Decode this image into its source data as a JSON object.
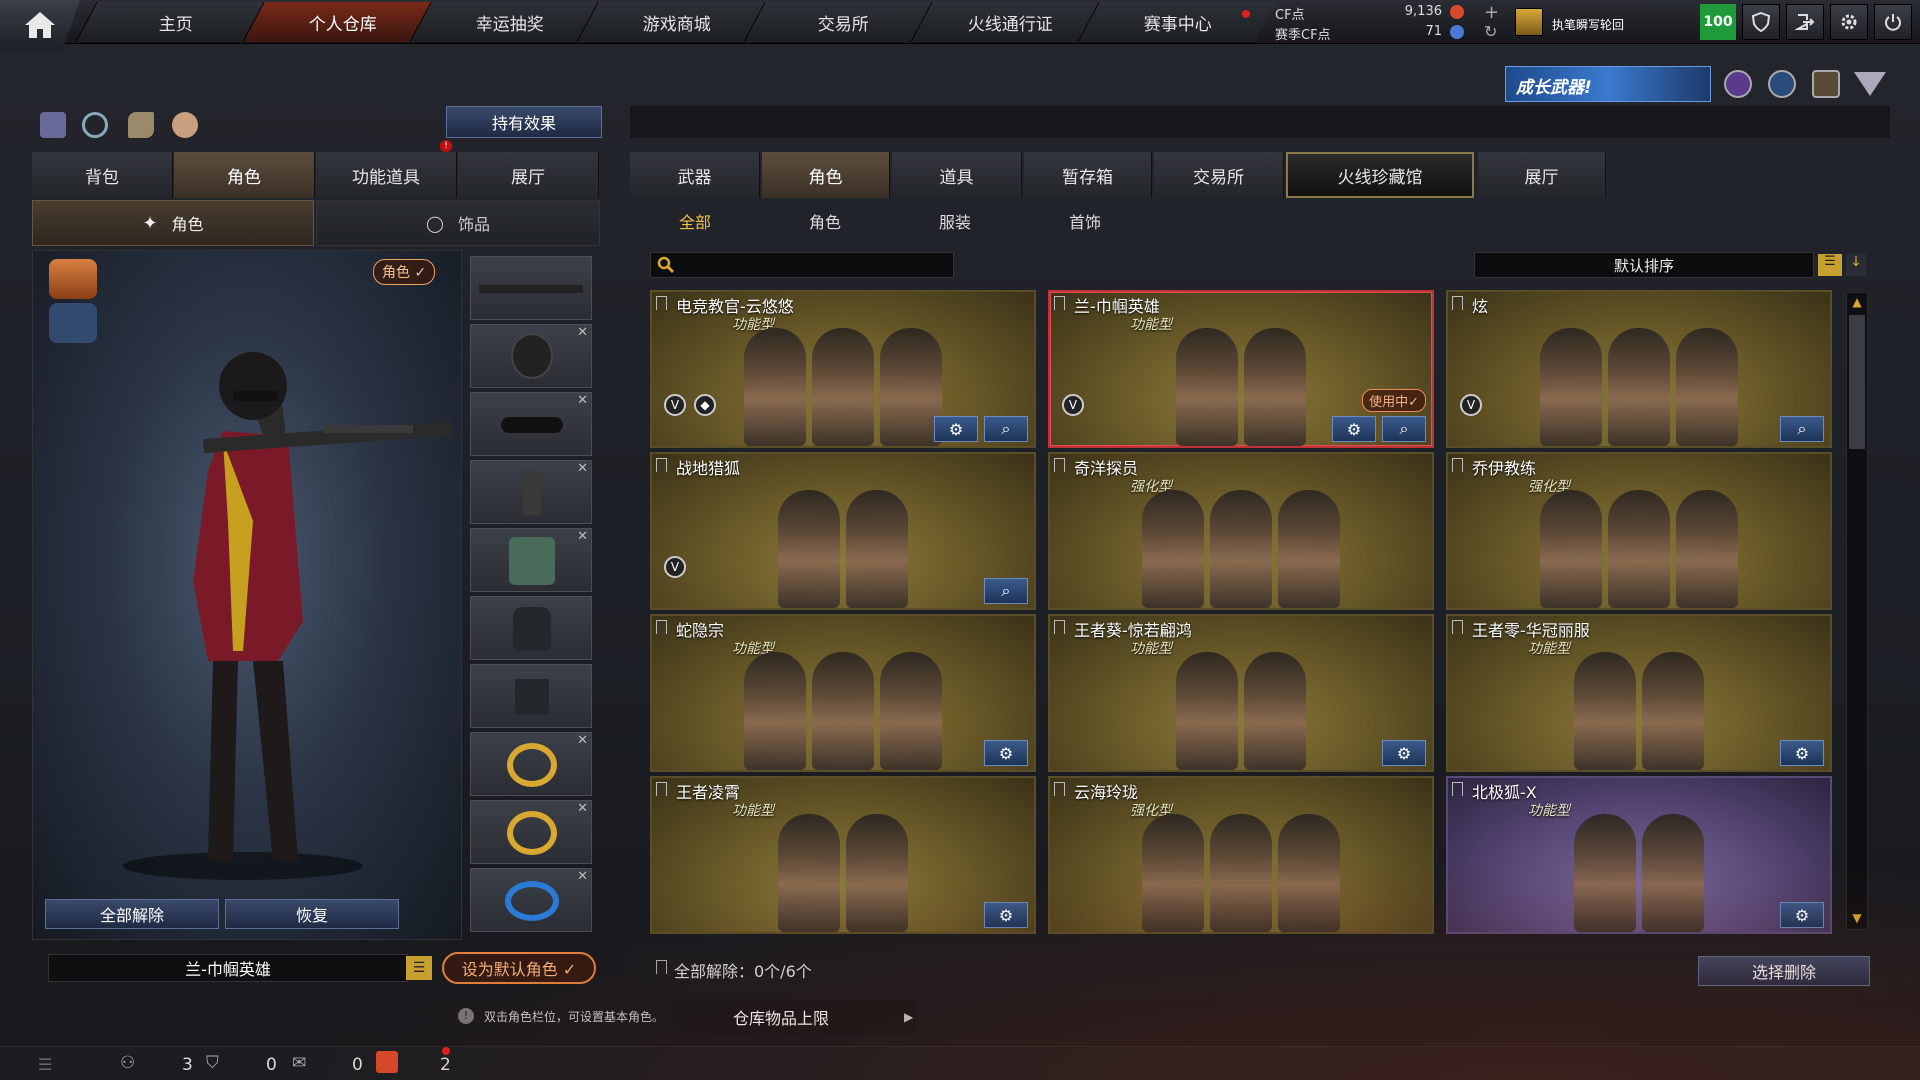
{
  "topnav": {
    "tabs": [
      "主页",
      "个人仓库",
      "幸运抽奖",
      "游戏商城",
      "交易所",
      "火线通行证",
      "赛事中心"
    ],
    "active_index": 1
  },
  "currency": {
    "cf_label": "CF点",
    "cf_value": "9,136",
    "season_label": "赛季CF点",
    "season_value": "71"
  },
  "user": {
    "name": "执笔瞬写轮回",
    "level": "100"
  },
  "banner": {
    "text": "成长武器!"
  },
  "left": {
    "effect_button": "持有效果",
    "tabs": [
      "背包",
      "角色",
      "功能道具",
      "展厅"
    ],
    "active_tab": 1,
    "subtabs": [
      "角色",
      "饰品"
    ],
    "role_badge": "角色 ✓",
    "unequip_all": "全部解除",
    "restore": "恢复",
    "current_role": "兰-巾帼英雄",
    "set_default": "设为默认角色 ✓"
  },
  "right": {
    "tabs": [
      "武器",
      "角色",
      "道具",
      "暂存箱",
      "交易所",
      "火线珍藏馆",
      "展厅"
    ],
    "active_tab": 1,
    "highlight_tab": 5,
    "subtabs": [
      "全部",
      "角色",
      "服装",
      "首饰"
    ],
    "active_subtab": 0,
    "search_placeholder": "",
    "sort_label": "默认排序",
    "cards": [
      {
        "name": "电竞教官-云悠悠",
        "tag": "功能型",
        "figures": 3,
        "icons": [
          "gear",
          "search"
        ],
        "badges": [
          "V",
          "shield"
        ]
      },
      {
        "name": "兰-巾帼英雄",
        "tag": "功能型",
        "figures": 2,
        "icons": [
          "gear",
          "search"
        ],
        "badges": [
          "V"
        ],
        "status": "使用中✓",
        "selected": true
      },
      {
        "name": "炫",
        "tag": "",
        "figures": 3,
        "icons": [
          "search"
        ],
        "badges": [
          "V"
        ]
      },
      {
        "name": "战地猎狐",
        "tag": "",
        "figures": 2,
        "icons": [
          "search"
        ],
        "badges": [
          "V"
        ]
      },
      {
        "name": "奇洋探员",
        "tag": "强化型",
        "figures": 3,
        "icons": [],
        "badges": []
      },
      {
        "name": "乔伊教练",
        "tag": "强化型",
        "figures": 3,
        "icons": [],
        "badges": []
      },
      {
        "name": "蛇隐宗",
        "tag": "功能型",
        "figures": 3,
        "icons": [
          "gear"
        ],
        "badges": []
      },
      {
        "name": "王者葵-惊若翩鸿",
        "tag": "功能型",
        "figures": 2,
        "icons": [
          "gear"
        ],
        "badges": []
      },
      {
        "name": "王者零-华冠丽服",
        "tag": "功能型",
        "figures": 2,
        "icons": [
          "gear"
        ],
        "badges": []
      },
      {
        "name": "王者凌霄",
        "tag": "功能型",
        "figures": 2,
        "icons": [
          "gear"
        ],
        "badges": []
      },
      {
        "name": "云海玲珑",
        "tag": "强化型",
        "figures": 3,
        "icons": [],
        "badges": []
      },
      {
        "name": "北极狐-X",
        "tag": "功能型",
        "figures": 2,
        "icons": [
          "gear"
        ],
        "badges": [],
        "purple": true
      }
    ],
    "footer_label": "全部解除：0个/6个",
    "delete_button": "选择删除"
  },
  "hint": {
    "text": "双击角色栏位，可设置基本角色。",
    "capacity": "仓库物品上限"
  },
  "statusbar": {
    "a": "3",
    "b": "0",
    "c": "0",
    "d": "2"
  }
}
